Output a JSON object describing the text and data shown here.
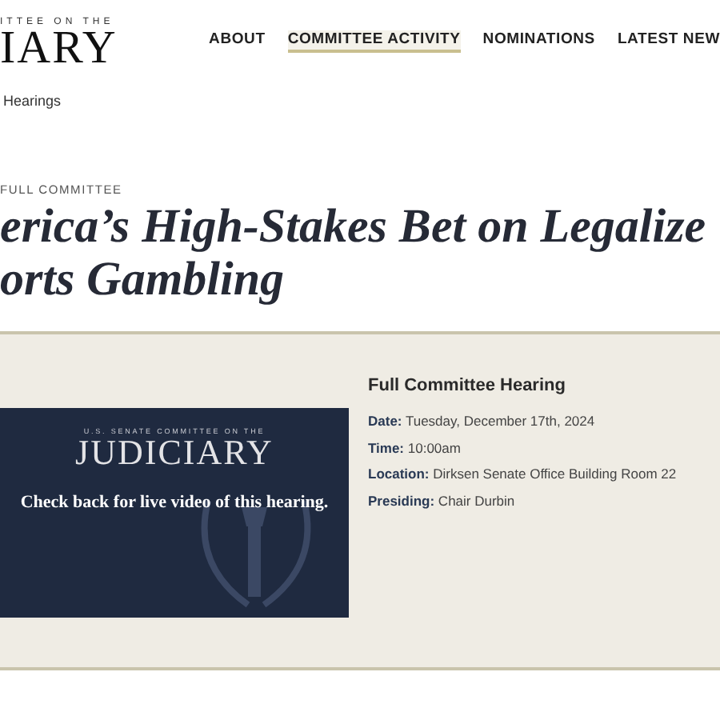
{
  "logo": {
    "tagline": "ITTEE ON THE",
    "name": "IARY"
  },
  "nav": [
    {
      "label": "ABOUT",
      "selected": false
    },
    {
      "label": "COMMITTEE ACTIVITY",
      "selected": true
    },
    {
      "label": "NOMINATIONS",
      "selected": false
    },
    {
      "label": "LATEST NEW",
      "selected": false
    }
  ],
  "breadcrumb": "Hearings",
  "category": "FULL COMMITTEE",
  "title": [
    "erica’s High-Stakes Bet on Legalize",
    "orts Gambling"
  ],
  "video": {
    "tagline": "U.S. SENATE COMMITTEE ON THE",
    "name": "JUDICIARY",
    "message": "Check back for live video of this hearing."
  },
  "details": {
    "heading": "Full Committee Hearing",
    "fields": [
      {
        "label": "Date:",
        "value": "Tuesday, December 17th, 2024"
      },
      {
        "label": "Time:",
        "value": "10:00am"
      },
      {
        "label": "Location:",
        "value": "Dirksen Senate Office Building Room 22"
      },
      {
        "label": "Presiding:",
        "value": "Chair Durbin"
      }
    ]
  }
}
